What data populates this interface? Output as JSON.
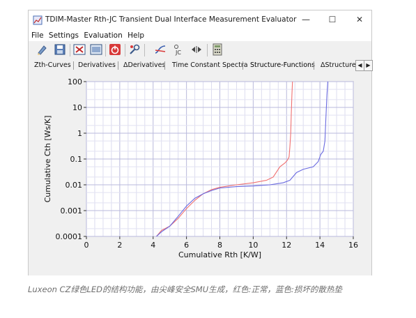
{
  "window": {
    "title": "TDIM-Master Rth-JC Transient Dual Interface Measurement Evaluator",
    "controls": {
      "minimize": "—",
      "maximize": "☐",
      "close": "✕"
    }
  },
  "menu": [
    "File",
    "Settings",
    "Evaluation",
    "Help"
  ],
  "toolbar": {
    "buttons": [
      "open-icon",
      "save-icon",
      "clear-icon",
      "view-icon",
      "power-icon",
      "tools-icon",
      "curve-icon",
      "jc-icon",
      "resize-icon",
      "calculator-icon"
    ],
    "jc_label": "JC"
  },
  "tabs": [
    "Zth-Curves",
    "Derivatives",
    "ΔDerivatives",
    "Time Constant Spectra",
    "Structure-Functions",
    "ΔStructure-"
  ],
  "active_tab": "Structure-Functions",
  "scroll": {
    "left": "◀",
    "right": "▶"
  },
  "chart_data": {
    "type": "line",
    "xlabel": "Cumulative Rth [K/W]",
    "ylabel": "Cumulative Cth [Ws/K]",
    "xlim": [
      0,
      16
    ],
    "ylim": [
      0.0001,
      100
    ],
    "yscale": "log",
    "grid": true,
    "x_ticks": [
      "0",
      "2",
      "4",
      "6",
      "8",
      "10",
      "12",
      "14",
      "16"
    ],
    "y_ticks": [
      "100",
      "10",
      "1",
      "0.1",
      "0.01",
      "0.001",
      "0.0001"
    ],
    "series": [
      {
        "color": "#f07070",
        "points": [
          [
            4.0,
            7e-05
          ],
          [
            4.2,
            0.0001
          ],
          [
            4.5,
            0.00017
          ],
          [
            5.0,
            0.00025
          ],
          [
            5.5,
            0.0005
          ],
          [
            6.0,
            0.0012
          ],
          [
            6.5,
            0.0025
          ],
          [
            7.0,
            0.0045
          ],
          [
            7.5,
            0.0065
          ],
          [
            8.0,
            0.008
          ],
          [
            9.0,
            0.01
          ],
          [
            10.0,
            0.012
          ],
          [
            10.8,
            0.015
          ],
          [
            11.2,
            0.02
          ],
          [
            11.6,
            0.05
          ],
          [
            11.9,
            0.07
          ],
          [
            12.05,
            0.09
          ],
          [
            12.15,
            0.12
          ],
          [
            12.2,
            0.3
          ],
          [
            12.25,
            1
          ],
          [
            12.28,
            5
          ],
          [
            12.32,
            30
          ],
          [
            12.36,
            120
          ]
        ]
      },
      {
        "color": "#6a6ae0",
        "points": [
          [
            4.0,
            7e-05
          ],
          [
            4.2,
            0.0001
          ],
          [
            4.5,
            0.00015
          ],
          [
            5.0,
            0.00025
          ],
          [
            5.5,
            0.0006
          ],
          [
            6.0,
            0.0015
          ],
          [
            6.5,
            0.003
          ],
          [
            7.0,
            0.0045
          ],
          [
            7.5,
            0.006
          ],
          [
            8.0,
            0.0075
          ],
          [
            9.0,
            0.0085
          ],
          [
            10.0,
            0.009
          ],
          [
            11.0,
            0.01
          ],
          [
            11.8,
            0.012
          ],
          [
            12.2,
            0.015
          ],
          [
            12.6,
            0.03
          ],
          [
            13.0,
            0.04
          ],
          [
            13.6,
            0.05
          ],
          [
            13.9,
            0.08
          ],
          [
            14.05,
            0.15
          ],
          [
            14.2,
            0.2
          ],
          [
            14.3,
            0.5
          ],
          [
            14.35,
            3
          ],
          [
            14.42,
            30
          ],
          [
            14.48,
            120
          ]
        ]
      }
    ]
  },
  "caption": "Luxeon CZ绿色LED的结构功能，由尖峰安全SMU生成，红色:正常，蓝色:损坏的散热垫"
}
